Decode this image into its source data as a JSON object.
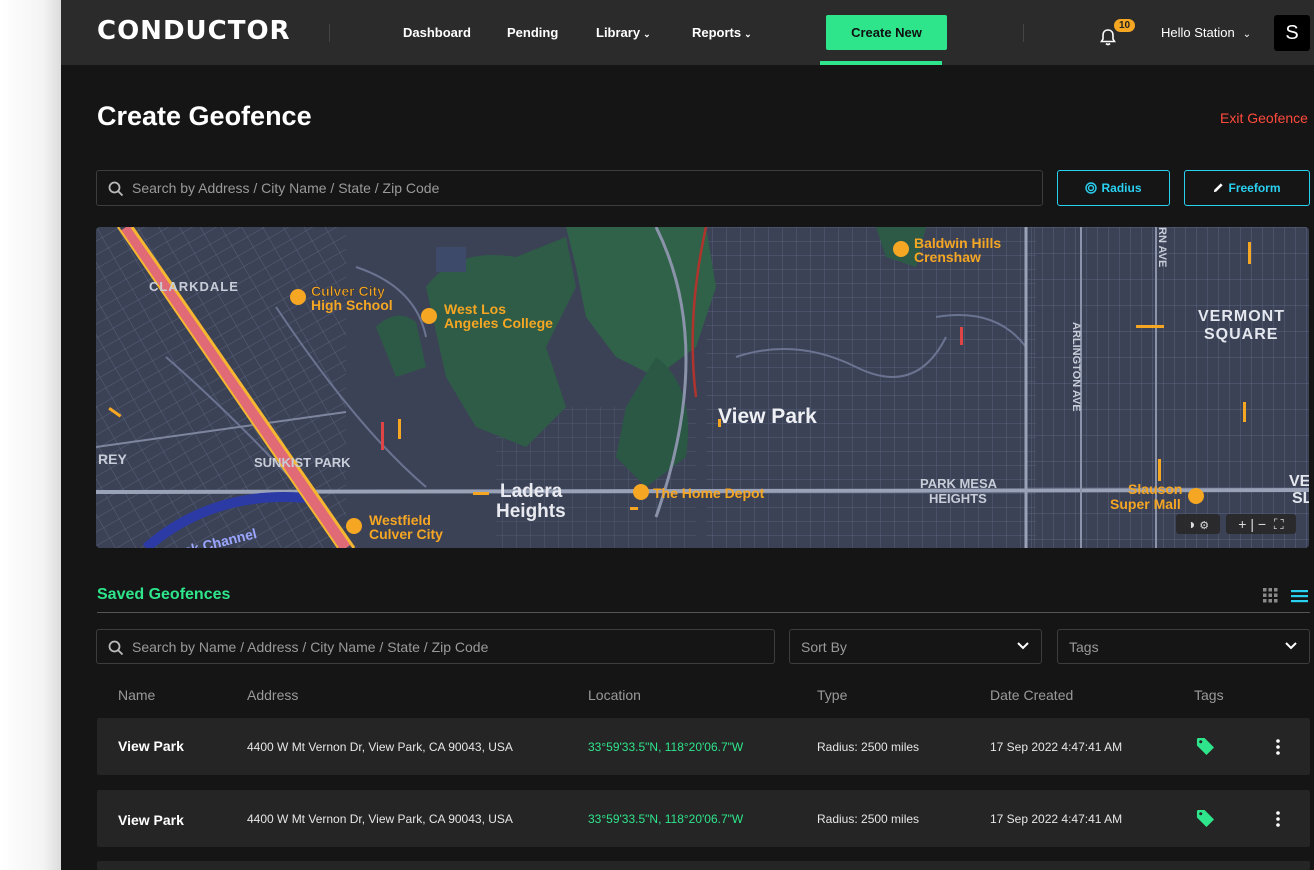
{
  "app": {
    "logo": "CONDUCTOR"
  },
  "nav": {
    "links": [
      "Dashboard",
      "Pending",
      "Library",
      "Reports"
    ],
    "create_button": "Create New",
    "notification_count": "10",
    "greeting": "Hello Station",
    "avatar_initial": "S"
  },
  "page": {
    "title": "Create Geofence",
    "exit_link": "Exit Geofence",
    "search_placeholder": "Search by Address / City Name / State / Zip Code",
    "radius_button": "Radius",
    "freeform_button": "Freeform"
  },
  "map": {
    "labels": {
      "clarkdale": "CLARKDALE",
      "culver_high_1": "Culver City",
      "culver_high_2": "High School",
      "wla_1": "West Los",
      "wla_2": "Angeles College",
      "baldwin_1": "Baldwin Hills",
      "baldwin_2": "Crenshaw",
      "vermont_1": "VERMONT",
      "vermont_2": "SQUARE",
      "view_park": "View Park",
      "rey": "REY",
      "sunkist": "SUNKIST PARK",
      "ladera_1": "Ladera",
      "ladera_2": "Heights",
      "home_depot": "The Home Depot",
      "park_mesa_1": "PARK MESA",
      "park_mesa_2": "HEIGHTS",
      "slauson_1": "Slauson",
      "slauson_2": "Super Mall",
      "westfield_1": "Westfield",
      "westfield_2": "Culver City",
      "creek": "Creek Channel",
      "arlington": "ARLINGTON AVE",
      "rn_ave": "RN AVE",
      "ve": "VE",
      "sl": "SL"
    }
  },
  "saved": {
    "title": "Saved Geofences",
    "search_placeholder": "Search by Name / Address / City Name / State / Zip Code",
    "sort_label": "Sort By",
    "tags_label": "Tags",
    "columns": [
      "Name",
      "Address",
      "Location",
      "Type",
      "Date Created",
      "Tags"
    ],
    "rows": [
      {
        "name": "View Park",
        "address": "4400 W Mt Vernon Dr, View Park, CA 90043, USA",
        "location": "33°59'33.5\"N, 118°20'06.7\"W",
        "type": "Radius: 2500 miles",
        "date": "17 Sep 2022 4:47:41 AM"
      },
      {
        "name": "View Park",
        "address": "4400 W Mt Vernon Dr, View Park, CA 90043, USA",
        "location": "33°59'33.5\"N, 118°20'06.7\"W",
        "type": "Radius: 2500 miles",
        "date": "17 Sep 2022 4:47:41 AM"
      }
    ]
  },
  "colors": {
    "accent": "#2ee58b",
    "cyan": "#2ad0f0",
    "danger": "#ff4a3d",
    "badge": "#f5a623",
    "poi": "#f5a623"
  }
}
